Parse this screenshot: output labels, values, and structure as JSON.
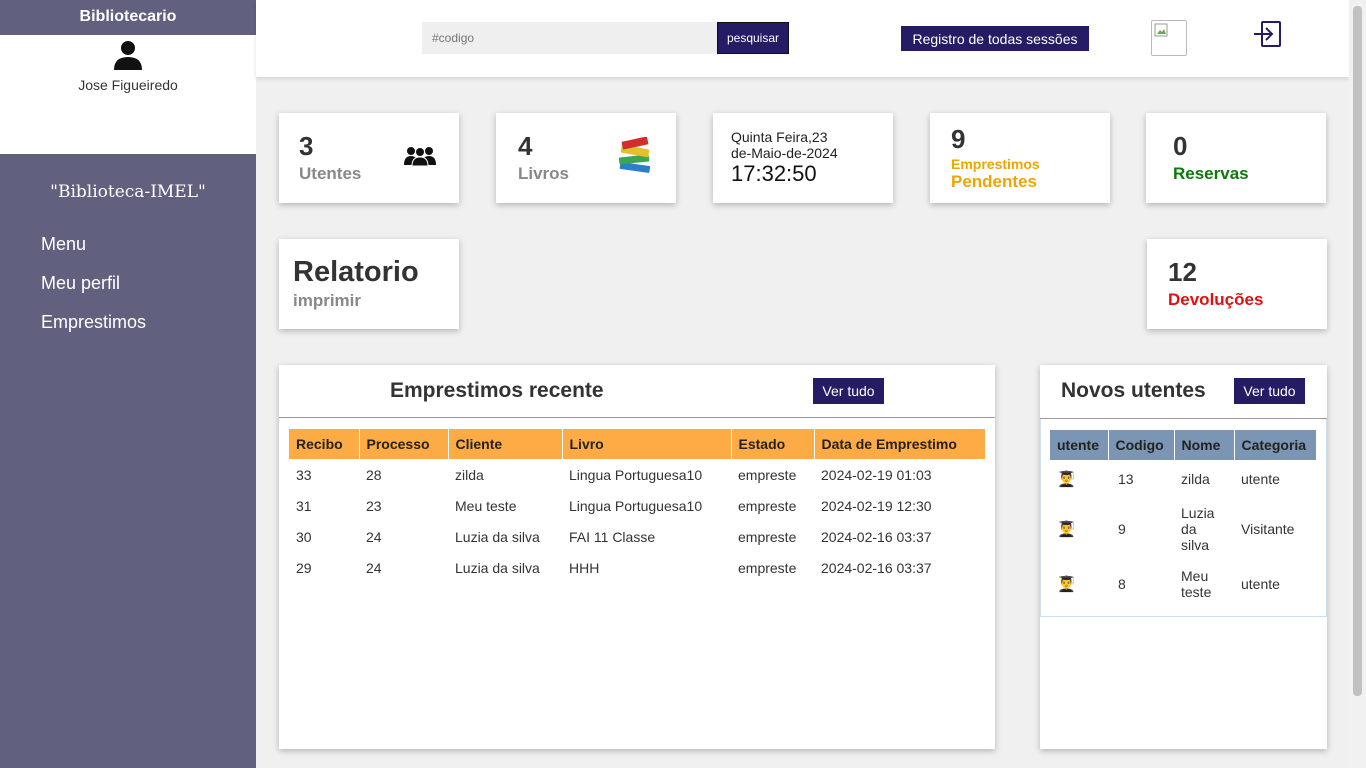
{
  "sidebar": {
    "role": "Bibliotecario",
    "user_name": "Jose Figueiredo",
    "brand": "\"Biblioteca-IMEL\"",
    "nav": [
      "Menu",
      "Meu perfil",
      "Emprestimos"
    ]
  },
  "topbar": {
    "search_placeholder": "#codigo",
    "search_button": "pesquisar",
    "sessions_button": "Registro de todas sessões"
  },
  "cards": {
    "utentes": {
      "count": "3",
      "label": "Utentes"
    },
    "livros": {
      "count": "4",
      "label": "Livros"
    },
    "datetime": {
      "day": "Quinta Feira,23",
      "date": "de-Maio-de-2024",
      "time": "17:32:50"
    },
    "emprestimos": {
      "count": "9",
      "label1": "Emprestimos",
      "label2": "Pendentes"
    },
    "reservas": {
      "count": "0",
      "label": "Reservas"
    },
    "relatorio": {
      "title": "Relatorio",
      "action": "imprimir"
    },
    "devolucoes": {
      "count": "12",
      "label": "Devoluções"
    }
  },
  "recent_loans": {
    "title": "Emprestimos recente",
    "view_all": "Ver tudo",
    "columns": [
      "Recibo",
      "Processo",
      "Cliente",
      "Livro",
      "Estado",
      "Data de Emprestimo"
    ],
    "rows": [
      [
        "33",
        "28",
        "zilda",
        "Lingua Portuguesa10",
        "empreste",
        "2024-02-19 01:03"
      ],
      [
        "31",
        "23",
        "Meu teste",
        "Lingua Portuguesa10",
        "empreste",
        "2024-02-19 12:30"
      ],
      [
        "30",
        "24",
        "Luzia da silva",
        "FAI 11 Classe",
        "empreste",
        "2024-02-16 03:37"
      ],
      [
        "29",
        "24",
        "Luzia da silva",
        "HHH",
        "empreste",
        "2024-02-16 03:37"
      ]
    ]
  },
  "new_users": {
    "title": "Novos utentes",
    "view_all": "Ver tudo",
    "columns": [
      "utente",
      "Codigo",
      "Nome",
      "Categoria"
    ],
    "rows": [
      {
        "codigo": "13",
        "nome": "zilda",
        "categoria": "utente"
      },
      {
        "codigo": "9",
        "nome": "Luzia da silva",
        "categoria": "Visitante"
      },
      {
        "codigo": "8",
        "nome": "Meu teste",
        "categoria": "utente"
      }
    ]
  },
  "colors": {
    "sidebar": "#61607e",
    "button": "#241c64",
    "loans_header": "#fdab45",
    "users_header": "#7b96b4",
    "pendentes": "#f0a500",
    "reservas": "#0b7a0b",
    "devolucoes": "#e01010"
  }
}
